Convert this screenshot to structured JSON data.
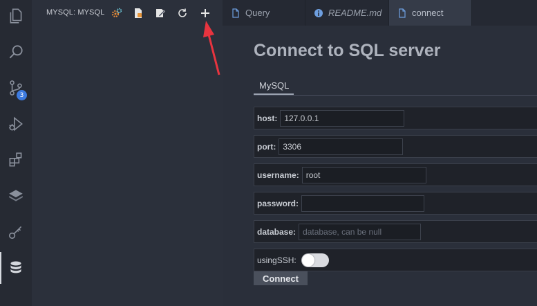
{
  "activity_bar": {
    "items": [
      {
        "icon": "files-icon"
      },
      {
        "icon": "search-icon"
      },
      {
        "icon": "source-control-icon",
        "badge": "3"
      },
      {
        "icon": "run-debug-icon"
      },
      {
        "icon": "extensions-icon"
      },
      {
        "icon": "stack-icon"
      },
      {
        "icon": "key-icon"
      },
      {
        "icon": "database-icon",
        "active": true
      }
    ]
  },
  "sidebar": {
    "title": "MYSQL: MYSQL",
    "actions": [
      "settings-icon",
      "new-file-icon",
      "edit-file-icon",
      "refresh-icon",
      "add-icon"
    ]
  },
  "tabs": [
    {
      "label": "Query",
      "icon": "file-icon"
    },
    {
      "label": "README.md",
      "icon": "info-icon"
    },
    {
      "label": "connect",
      "icon": "file-icon",
      "active": true
    }
  ],
  "form": {
    "heading": "Connect to SQL server",
    "subtab": "MySQL",
    "host_label": "host:",
    "host_value": "127.0.0.1",
    "port_label": "port:",
    "port_value": "3306",
    "username_label": "username:",
    "username_value": "root",
    "password_label": "password:",
    "password_value": "",
    "database_label": "database:",
    "database_placeholder": "database, can be null",
    "ssh_label": "usingSSH:",
    "ssh_enabled": false,
    "connect_label": "Connect"
  },
  "colors": {
    "badge": "#3d7be0",
    "annotation_arrow": "#e8343f"
  }
}
